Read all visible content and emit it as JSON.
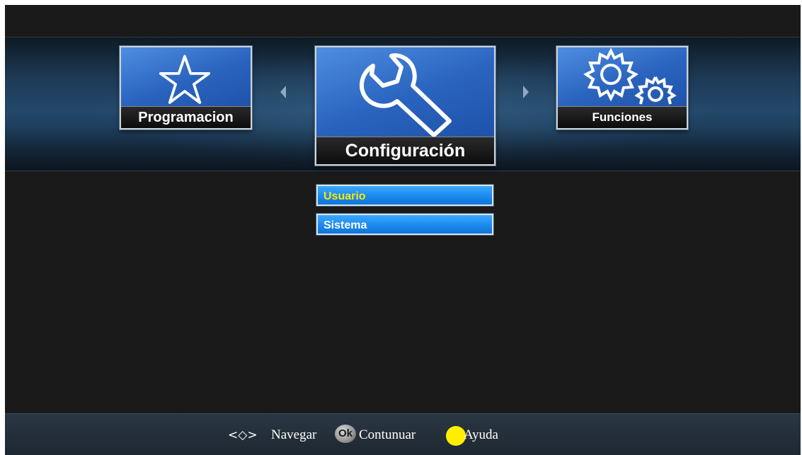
{
  "menu_tiles": {
    "left": {
      "label": "Programacion",
      "icon": "star-icon"
    },
    "center": {
      "label": "Configuración",
      "icon": "wrench-icon"
    },
    "right": {
      "label": "Funciones",
      "icon": "gears-icon"
    }
  },
  "submenu": {
    "items": [
      {
        "label": "Usuario",
        "selected": true
      },
      {
        "label": "Sistema",
        "selected": false
      }
    ]
  },
  "footer": {
    "navigate_symbol": "<◇>",
    "navigate_label": "Navegar",
    "ok_symbol": "Ok",
    "continue_label": "Contunuar",
    "help_label": "Ayuda"
  },
  "colors": {
    "tile_blue": "#2a64bf",
    "menu_blue": "#1e8cf0",
    "selected_text": "#ffe800",
    "help_dot": "#ffee00"
  }
}
